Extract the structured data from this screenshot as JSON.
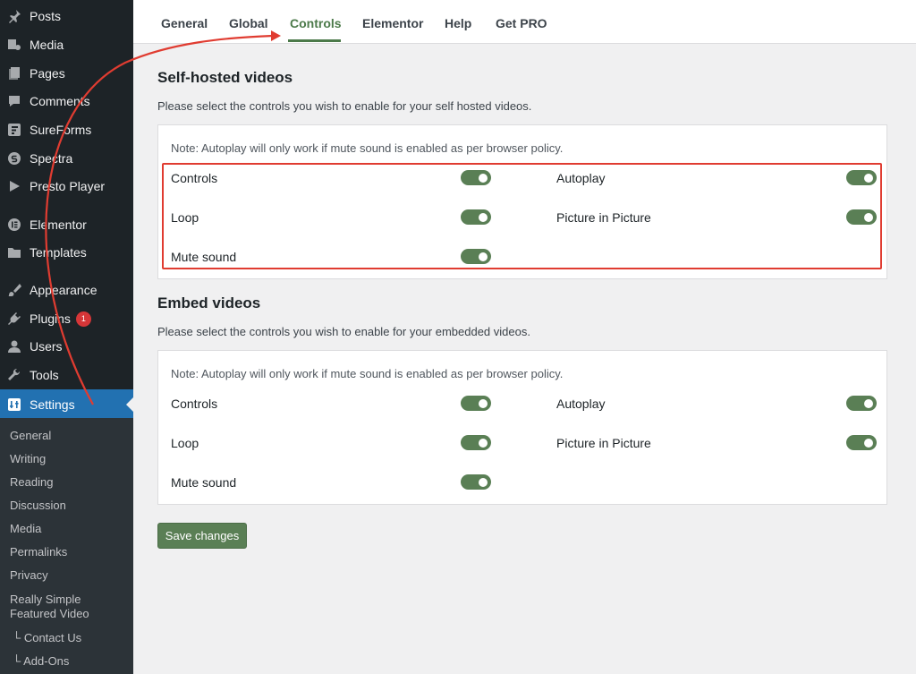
{
  "sidebar": {
    "items": [
      {
        "label": "Posts",
        "icon": "pin-icon"
      },
      {
        "label": "Media",
        "icon": "media-icon"
      },
      {
        "label": "Pages",
        "icon": "pages-icon"
      },
      {
        "label": "Comments",
        "icon": "comments-icon"
      },
      {
        "label": "SureForms",
        "icon": "sureforms-icon"
      },
      {
        "label": "Spectra",
        "icon": "spectra-icon"
      },
      {
        "label": "Presto Player",
        "icon": "presto-player-icon"
      },
      {
        "label": "Elementor",
        "icon": "elementor-icon"
      },
      {
        "label": "Templates",
        "icon": "folder-icon"
      },
      {
        "label": "Appearance",
        "icon": "brush-icon"
      },
      {
        "label": "Plugins",
        "icon": "plugin-icon",
        "badge": "1"
      },
      {
        "label": "Users",
        "icon": "user-icon"
      },
      {
        "label": "Tools",
        "icon": "wrench-icon"
      },
      {
        "label": "Settings",
        "icon": "settings-icon"
      }
    ],
    "submenu": [
      "General",
      "Writing",
      "Reading",
      "Discussion",
      "Media",
      "Permalinks",
      "Privacy",
      "Really Simple Featured Video",
      "└ Contact Us",
      "└ Add-Ons"
    ]
  },
  "tabs": [
    "General",
    "Global",
    "Controls",
    "Elementor",
    "Help",
    "Get PRO"
  ],
  "active_tab": "Controls",
  "self_hosted": {
    "title": "Self-hosted videos",
    "description": "Please select the controls you wish to enable for your self hosted videos.",
    "note": "Note: Autoplay will only work if mute sound is enabled as per browser policy.",
    "left": [
      {
        "label": "Controls",
        "enabled": true
      },
      {
        "label": "Loop",
        "enabled": true
      },
      {
        "label": "Mute sound",
        "enabled": true
      }
    ],
    "right": [
      {
        "label": "Autoplay",
        "enabled": true
      },
      {
        "label": "Picture in Picture",
        "enabled": true
      }
    ]
  },
  "embed": {
    "title": "Embed videos",
    "description": "Please select the controls you wish to enable for your embedded videos.",
    "note": "Note: Autoplay will only work if mute sound is enabled as per browser policy.",
    "left": [
      {
        "label": "Controls",
        "enabled": true
      },
      {
        "label": "Loop",
        "enabled": true
      },
      {
        "label": "Mute sound",
        "enabled": true
      }
    ],
    "right": [
      {
        "label": "Autoplay",
        "enabled": true
      },
      {
        "label": "Picture in Picture",
        "enabled": true
      }
    ]
  },
  "save_label": "Save changes",
  "colors": {
    "accent": "#5a7f55",
    "wp_blue": "#2271b1",
    "annotation_red": "#e03c31"
  }
}
